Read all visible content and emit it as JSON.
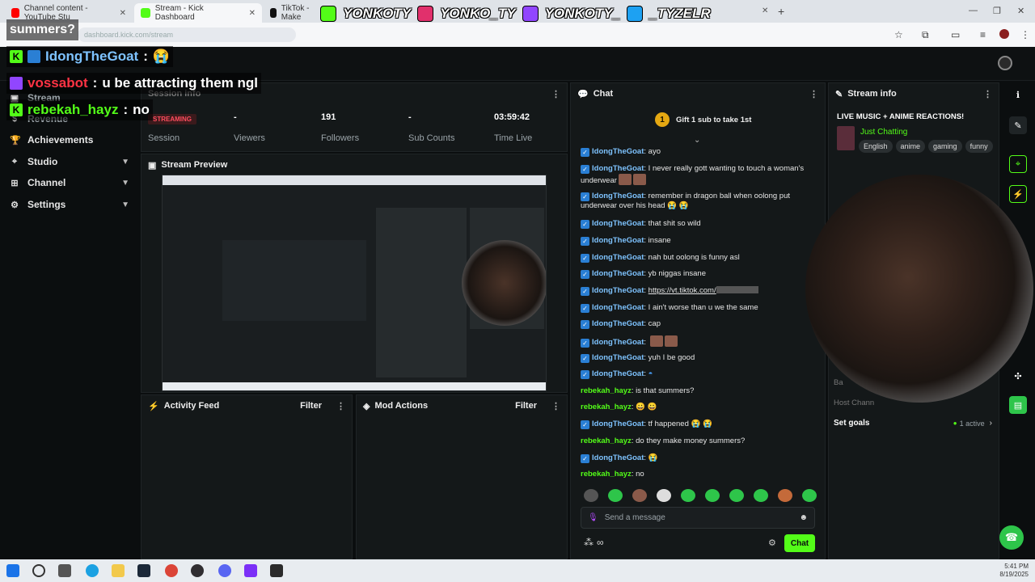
{
  "browser": {
    "tabs": [
      {
        "title": "Channel content - YouTube Stu",
        "color": "#ff0000"
      },
      {
        "title": "Stream - Kick Dashboard",
        "color": "#53fc18"
      },
      {
        "title": "TikTok - Make",
        "color": "#111111"
      }
    ],
    "url": "dashboard.kick.com/stream"
  },
  "overlay": {
    "socials": [
      {
        "handle": "YONKOTY",
        "icon": "kick-icon",
        "color": "#53fc18"
      },
      {
        "handle": "YONKO_TY",
        "icon": "instagram-icon",
        "color": "#e1306c"
      },
      {
        "handle": "YONKOTY_",
        "icon": "twitch-icon",
        "color": "#9146ff"
      },
      {
        "handle": "_TYZELR",
        "icon": "twitter-icon",
        "color": "#1da1f2"
      }
    ],
    "chat_lines": [
      {
        "user": "",
        "text": "summers?"
      },
      {
        "user": "IdongTheGoat",
        "sep": " : ",
        "text": "😭",
        "badge": "kick"
      },
      {
        "user": "vossabot",
        "sep": " : ",
        "text": "u be attracting them ngl",
        "badge": "twitch"
      },
      {
        "user": "rebekah_hayz",
        "sep": " : ",
        "text": "no",
        "badge": "kick"
      }
    ]
  },
  "sidebar": {
    "items": [
      {
        "label": "Stream"
      },
      {
        "label": "Revenue"
      },
      {
        "label": "Achievements"
      },
      {
        "label": "Studio"
      },
      {
        "label": "Channel"
      },
      {
        "label": "Settings"
      }
    ]
  },
  "session": {
    "title": "Session info",
    "status_badge": "STREAMING",
    "session_label": "Session",
    "stats": [
      {
        "value": "-",
        "label": "Viewers"
      },
      {
        "value": "191",
        "label": "Followers"
      },
      {
        "value": "-",
        "label": "Sub Counts"
      },
      {
        "value": "03:59:42",
        "label": "Time Live"
      }
    ]
  },
  "preview": {
    "title": "Stream Preview"
  },
  "activity": {
    "title": "Activity Feed",
    "filter": "Filter"
  },
  "mod": {
    "title": "Mod Actions",
    "filter": "Filter"
  },
  "chat": {
    "title": "Chat",
    "gift_count": "1",
    "gift_text": "Gift 1 sub to take 1st",
    "messages": [
      {
        "user": "IdongTheGoat",
        "text": "ayo"
      },
      {
        "user": "IdongTheGoat",
        "text": "I never really gott wanting to touch a woman's underwear"
      },
      {
        "user": "IdongTheGoat",
        "text": "remember in dragon ball when oolong put underwear over his head 😭 😭"
      },
      {
        "user": "IdongTheGoat",
        "text": "that shit so wild"
      },
      {
        "user": "IdongTheGoat",
        "text": "insane"
      },
      {
        "user": "IdongTheGoat",
        "text": "nah but oolong is funny asl"
      },
      {
        "user": "IdongTheGoat",
        "text": "yb niggas insane"
      },
      {
        "user": "IdongTheGoat",
        "text": "https://vt.tiktok.com/"
      },
      {
        "user": "IdongTheGoat",
        "text": "I ain't worse than u we the same"
      },
      {
        "user": "IdongTheGoat",
        "text": "cap"
      },
      {
        "user": "IdongTheGoat",
        "text": ""
      },
      {
        "user": "IdongTheGoat",
        "text": "yuh I be good"
      },
      {
        "user": "IdongTheGoat",
        "text": ""
      },
      {
        "user": "rebekah_hayz",
        "text": "is that summers?"
      },
      {
        "user": "rebekah_hayz",
        "text": "😀 😀"
      },
      {
        "user": "IdongTheGoat",
        "text": "tf happened 😭 😭"
      },
      {
        "user": "rebekah_hayz",
        "text": "do they make money summers?"
      },
      {
        "user": "IdongTheGoat",
        "text": "😭"
      },
      {
        "user": "rebekah_hayz",
        "text": "no"
      }
    ],
    "input_placeholder": "Send a message",
    "infinity": "∞",
    "send_label": "Chat"
  },
  "stream_info": {
    "title": "Stream info",
    "stream_title": "LIVE MUSIC + ANIME REACTIONS!",
    "category": "Just Chatting",
    "tags": [
      "English",
      "anime",
      "gaming",
      "funny"
    ],
    "ban_label": "Ba",
    "host_label": "Host Chann",
    "goals_label": "Set goals",
    "goals_status": "1 active"
  },
  "taskbar": {
    "time": "5:41 PM",
    "date": "8/19/2025"
  },
  "colors": {
    "kick_green": "#53fc18",
    "background": "#0b0e0f",
    "panel": "#141819",
    "streaming_red": "#ff4d5e"
  }
}
